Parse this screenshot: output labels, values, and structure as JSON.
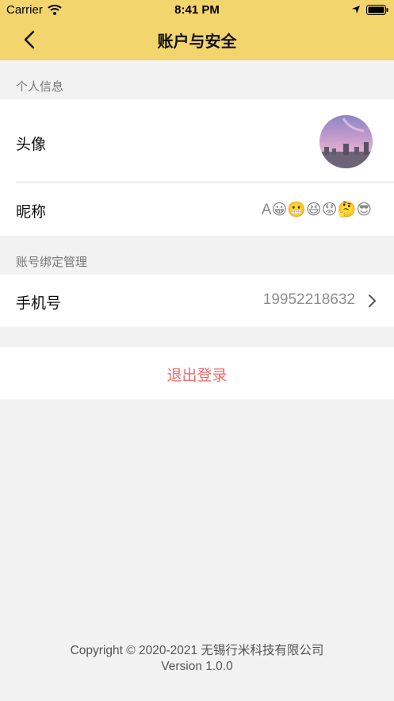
{
  "status_bar": {
    "carrier": "Carrier",
    "time": "8:41 PM"
  },
  "nav": {
    "title": "账户与安全"
  },
  "sections": {
    "personal_info": "个人信息",
    "account_binding": "账号绑定管理"
  },
  "rows": {
    "avatar_label": "头像",
    "nickname_label": "昵称",
    "nickname_value": "A😀😬😆😟🤔😎",
    "phone_label": "手机号",
    "phone_value": "19952218632"
  },
  "logout": {
    "label": "退出登录"
  },
  "footer": {
    "copyright": "Copyright © 2020-2021 无锡行米科技有限公司",
    "version": "Version 1.0.0"
  },
  "colors": {
    "header": "#f3d56e",
    "logout": "#f06a6a",
    "background": "#f2f2f2"
  },
  "icons": [
    "wifi-icon",
    "location-icon",
    "battery-icon",
    "back-icon",
    "chevron-right-icon"
  ]
}
